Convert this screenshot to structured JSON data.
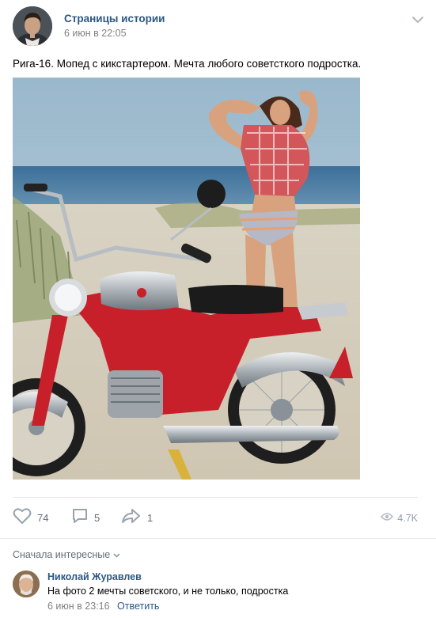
{
  "post": {
    "author": "Страницы истории",
    "date": "6 июн в 22:05",
    "text": "Рига-16. Мопед с кикстартером. Мечта любого советсткого подростка.",
    "image_alt": "Red Riga-16 moped on a sandy beach with a woman in a checkered shirt behind it"
  },
  "actions": {
    "likes": "74",
    "comments": "5",
    "shares": "1",
    "views": "4.7K"
  },
  "comments_section": {
    "sort_label": "Сначала интересные"
  },
  "comment": {
    "author": "Николай Журавлев",
    "text": "На фото 2 мечты советского, и не только, подростка",
    "date": "6 июн в 23:16",
    "reply_label": "Ответить"
  },
  "colors": {
    "link": "#2a5885",
    "muted": "#828282",
    "icon": "#99a2ad",
    "divider": "#e7e8ec"
  },
  "icons": [
    "chevron-down-icon",
    "heart-icon",
    "comment-icon",
    "share-icon",
    "eye-icon"
  ]
}
